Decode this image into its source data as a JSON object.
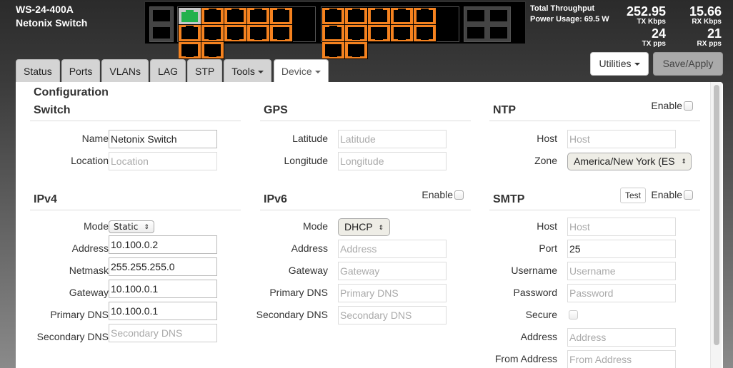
{
  "header": {
    "model": "WS-24-400A",
    "name": "Netonix Switch"
  },
  "faceplate": {
    "left_sfp_ports": 2,
    "rj45_ports": 24,
    "right_sfp_ports": 4,
    "active_ports": [
      1
    ],
    "colors": {
      "port": "#f5821f",
      "active_link": "#22b14c",
      "sfp": "#444444"
    }
  },
  "throughput": {
    "title": "Total Throughput",
    "power_usage": "Power Usage: 69.5 W",
    "tx_kbps": "252.95",
    "tx_kbps_label": "TX Kbps",
    "rx_kbps": "15.66",
    "rx_kbps_label": "RX Kbps",
    "tx_pps": "24",
    "tx_pps_label": "TX pps",
    "rx_pps": "21",
    "rx_pps_label": "RX pps"
  },
  "tabs": [
    {
      "label": "Status"
    },
    {
      "label": "Ports"
    },
    {
      "label": "VLANs"
    },
    {
      "label": "LAG"
    },
    {
      "label": "STP"
    },
    {
      "label": "Tools",
      "dropdown": true
    },
    {
      "label": "Device",
      "dropdown": true,
      "active": true
    }
  ],
  "buttons": {
    "utilities": "Utilities",
    "save_apply": "Save/Apply"
  },
  "page": {
    "title": "Configuration"
  },
  "switch": {
    "title": "Switch",
    "name_label": "Name",
    "name_value": "Netonix Switch",
    "location_label": "Location",
    "location_placeholder": "Location"
  },
  "gps": {
    "title": "GPS",
    "latitude_label": "Latitude",
    "latitude_placeholder": "Latitude",
    "longitude_label": "Longitude",
    "longitude_placeholder": "Longitude"
  },
  "ntp": {
    "title": "NTP",
    "enable_label": "Enable",
    "enabled": false,
    "host_label": "Host",
    "host_placeholder": "Host",
    "zone_label": "Zone",
    "zone_value": "America/New York (ES"
  },
  "ipv4": {
    "title": "IPv4",
    "mode_label": "Mode",
    "mode_value": "Static",
    "address_label": "Address",
    "address_value": "10.100.0.2",
    "netmask_label": "Netmask",
    "netmask_value": "255.255.255.0",
    "gateway_label": "Gateway",
    "gateway_value": "10.100.0.1",
    "dns1_label": "Primary DNS",
    "dns1_value": "10.100.0.1",
    "dns2_label": "Secondary DNS",
    "dns2_placeholder": "Secondary DNS"
  },
  "ipv6": {
    "title": "IPv6",
    "enable_label": "Enable",
    "enabled": false,
    "mode_label": "Mode",
    "mode_value": "DHCP",
    "address_label": "Address",
    "address_placeholder": "Address",
    "gateway_label": "Gateway",
    "gateway_placeholder": "Gateway",
    "dns1_label": "Primary DNS",
    "dns1_placeholder": "Primary DNS",
    "dns2_label": "Secondary DNS",
    "dns2_placeholder": "Secondary DNS"
  },
  "smtp": {
    "title": "SMTP",
    "test_label": "Test",
    "enable_label": "Enable",
    "enabled": false,
    "host_label": "Host",
    "host_placeholder": "Host",
    "port_label": "Port",
    "port_value": "25",
    "username_label": "Username",
    "username_placeholder": "Username",
    "password_label": "Password",
    "password_placeholder": "Password",
    "secure_label": "Secure",
    "secure": false,
    "address_label": "Address",
    "address_placeholder": "Address",
    "from_label": "From Address",
    "from_placeholder": "From Address"
  }
}
